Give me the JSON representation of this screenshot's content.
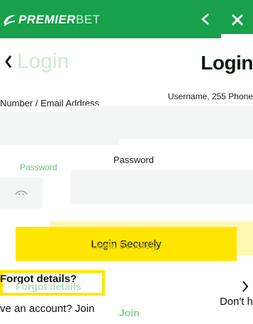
{
  "brand": {
    "logo_text_bold": "PREMIER",
    "logo_text_light": "BET",
    "header_color": "#18a04a"
  },
  "header": {
    "close_icon": "close-icon"
  },
  "login": {
    "heading_left": "Login",
    "heading_right": "Login",
    "username_label_left": "Number / Email Address",
    "username_label_right": "Username, 255 Phone",
    "password_label_right": "Password",
    "password_label_left": "Password",
    "submit_label": "Login Securely",
    "submit_label_ghost": "Login Securely",
    "forgot_label": "Forgot details?",
    "forgot_ghost": "Forgot details",
    "account_text_left": "ve an account? Join",
    "join_ghost": "Join",
    "account_text_right": "Don't h",
    "accent_yellow": "#ffe600"
  }
}
